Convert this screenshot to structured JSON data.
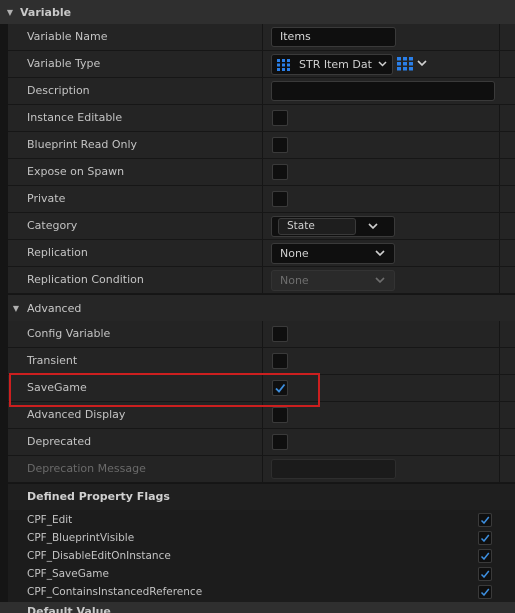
{
  "sections": {
    "variable": {
      "title": "Variable"
    },
    "advanced": {
      "title": "Advanced"
    },
    "default_value": {
      "title": "Default Value"
    }
  },
  "rows": {
    "variable_name": {
      "label": "Variable Name",
      "value": "Items"
    },
    "variable_type": {
      "label": "Variable Type",
      "value": "STR Item Data",
      "icon": "struct-grid-icon",
      "container_icon": "array-grid-icon"
    },
    "description": {
      "label": "Description",
      "value": ""
    },
    "instance_editable": {
      "label": "Instance Editable",
      "checked": false
    },
    "blueprint_read_only": {
      "label": "Blueprint Read Only",
      "checked": false
    },
    "expose_on_spawn": {
      "label": "Expose on Spawn",
      "checked": false
    },
    "private": {
      "label": "Private",
      "checked": false
    },
    "category": {
      "label": "Category",
      "value": "State"
    },
    "replication": {
      "label": "Replication",
      "value": "None"
    },
    "replication_condition": {
      "label": "Replication Condition",
      "value": "None"
    },
    "config_variable": {
      "label": "Config Variable",
      "checked": false
    },
    "transient": {
      "label": "Transient",
      "checked": false
    },
    "save_game": {
      "label": "SaveGame",
      "checked": true
    },
    "advanced_display": {
      "label": "Advanced Display",
      "checked": false
    },
    "deprecated": {
      "label": "Deprecated",
      "checked": false
    },
    "deprecation_message": {
      "label": "Deprecation Message",
      "value": ""
    }
  },
  "flags": {
    "title": "Defined Property Flags",
    "items": [
      {
        "label": "CPF_Edit",
        "checked": true
      },
      {
        "label": "CPF_BlueprintVisible",
        "checked": true
      },
      {
        "label": "CPF_DisableEditOnInstance",
        "checked": true
      },
      {
        "label": "CPF_SaveGame",
        "checked": true
      },
      {
        "label": "CPF_ContainsInstancedReference",
        "checked": true
      }
    ]
  },
  "colors": {
    "highlight": "#cc1f1f",
    "check": "#3d8fe0",
    "type_icon": "#2a7fe8"
  }
}
